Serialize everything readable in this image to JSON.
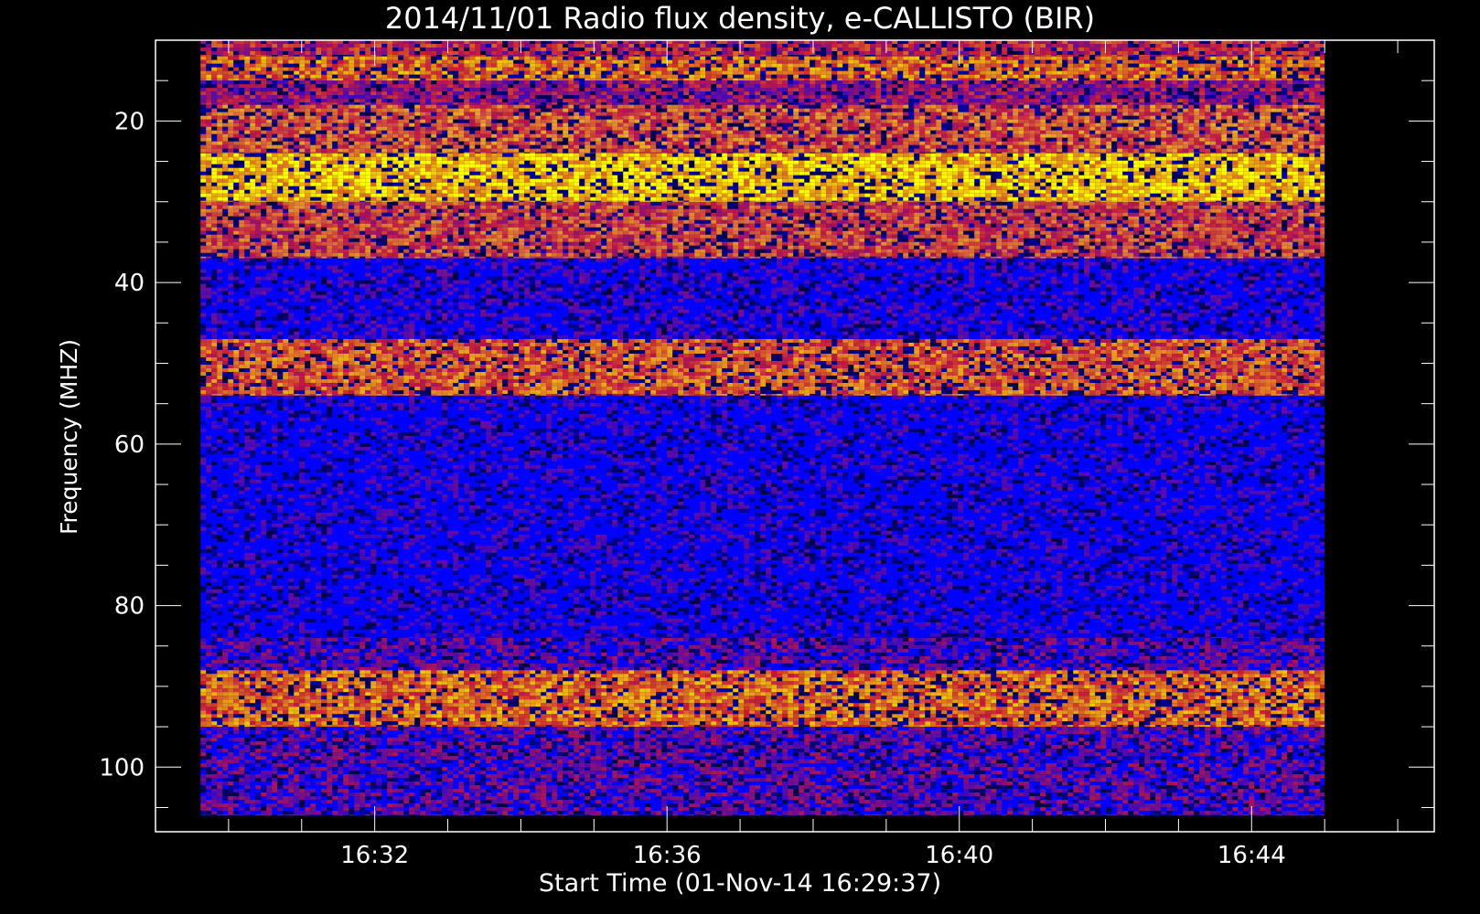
{
  "chart_data": {
    "type": "heatmap",
    "title": "2014/11/01  Radio flux density, e-CALLISTO (BIR)",
    "xlabel": "Start Time (01-Nov-14 16:29:37)",
    "ylabel": "Frequency (MHZ)",
    "x_start": "16:29:37",
    "x_end": "16:45:00",
    "xlim": [
      "16:29:00",
      "16:46:30"
    ],
    "ylim": [
      10,
      108
    ],
    "y_inverted": true,
    "data_ylim": [
      10,
      106
    ],
    "x_ticks": [
      "16:32",
      "16:36",
      "16:40",
      "16:44"
    ],
    "y_ticks": [
      20,
      40,
      60,
      80,
      100
    ],
    "grid": false,
    "colormap": [
      "#0000ff",
      "#ff2000",
      "#ffff00"
    ],
    "background_color": "#000000",
    "frequency_bands": [
      {
        "from": 10,
        "to": 12,
        "intensity": 0.45
      },
      {
        "from": 12,
        "to": 15,
        "intensity": 0.65
      },
      {
        "from": 15,
        "to": 18,
        "intensity": 0.35
      },
      {
        "from": 18,
        "to": 24,
        "intensity": 0.6
      },
      {
        "from": 24,
        "to": 30,
        "intensity": 0.85
      },
      {
        "from": 30,
        "to": 37,
        "intensity": 0.55
      },
      {
        "from": 37,
        "to": 47,
        "intensity": 0.08
      },
      {
        "from": 47,
        "to": 54,
        "intensity": 0.6
      },
      {
        "from": 54,
        "to": 84,
        "intensity": 0.05
      },
      {
        "from": 84,
        "to": 88,
        "intensity": 0.2
      },
      {
        "from": 88,
        "to": 95,
        "intensity": 0.65
      },
      {
        "from": 95,
        "to": 106,
        "intensity": 0.2
      }
    ]
  }
}
